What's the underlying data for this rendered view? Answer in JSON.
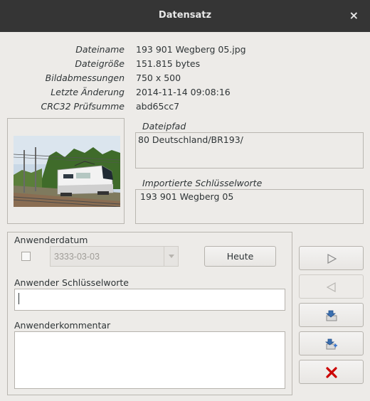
{
  "window": {
    "title": "Datensatz",
    "close_glyph": "×"
  },
  "info": {
    "filename_label": "Dateiname",
    "filename_value": "193 901 Wegberg 05.jpg",
    "filesize_label": "Dateigröße",
    "filesize_value": "151.815 bytes",
    "dimensions_label": "Bildabmessungen",
    "dimensions_value": "750 x 500",
    "modified_label": "Letzte Änderung",
    "modified_value": "2014-11-14  09:08:16",
    "crc_label": "CRC32 Prüfsumme",
    "crc_value": "abd65cc7"
  },
  "path": {
    "label": "Dateipfad",
    "value": "80 Deutschland/BR193/"
  },
  "imported_keywords": {
    "label": "Importierte Schlüsselworte",
    "value": "193 901 Wegberg 05"
  },
  "user": {
    "date_label": "Anwenderdatum",
    "date_value": "3333-03-03",
    "date_checked": false,
    "today_button": "Heute",
    "keywords_label": "Anwender Schlüsselworte",
    "keywords_value": "",
    "comment_label": "Anwenderkommentar",
    "comment_value": ""
  },
  "side_buttons": {
    "next_icon": "play-right-icon",
    "prev_icon": "play-left-icon",
    "import_icon": "import-icon",
    "import_add_icon": "import-add-icon",
    "delete_icon": "delete-x-icon",
    "delete_color": "#cc0000",
    "accent_color": "#3a6fb0"
  }
}
